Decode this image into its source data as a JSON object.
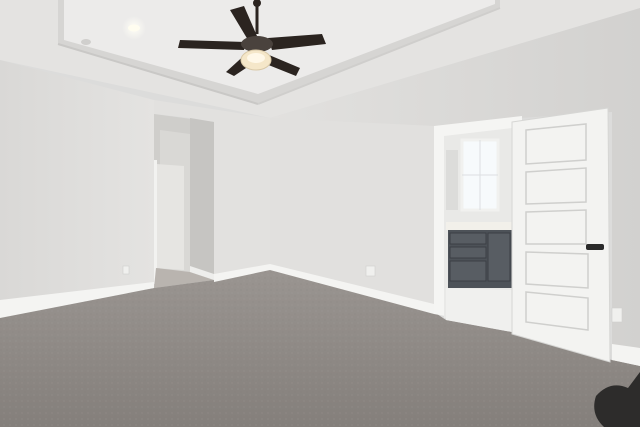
{
  "scene": {
    "subject": "empty-bedroom-interior",
    "elements": [
      "ceiling-fan",
      "tray-ceiling",
      "recessed-light",
      "carpet-floor",
      "open-paneled-door",
      "hallway-opening",
      "bathroom-vanity",
      "bathroom-window",
      "wall-outlet"
    ]
  },
  "colors": {
    "ceiling": "#e6e6e4",
    "tray_inner": "#ecebea",
    "wall_left": "#dddcda",
    "wall_back": "#e3e2e0",
    "wall_right": "#d8d7d5",
    "carpet": "#8f8a86",
    "baseboard": "#f4f4f2",
    "door": "#f3f3f1",
    "fan_blade": "#2b2420",
    "vanity": "#4d5258",
    "window_light": "#f7fafc"
  }
}
